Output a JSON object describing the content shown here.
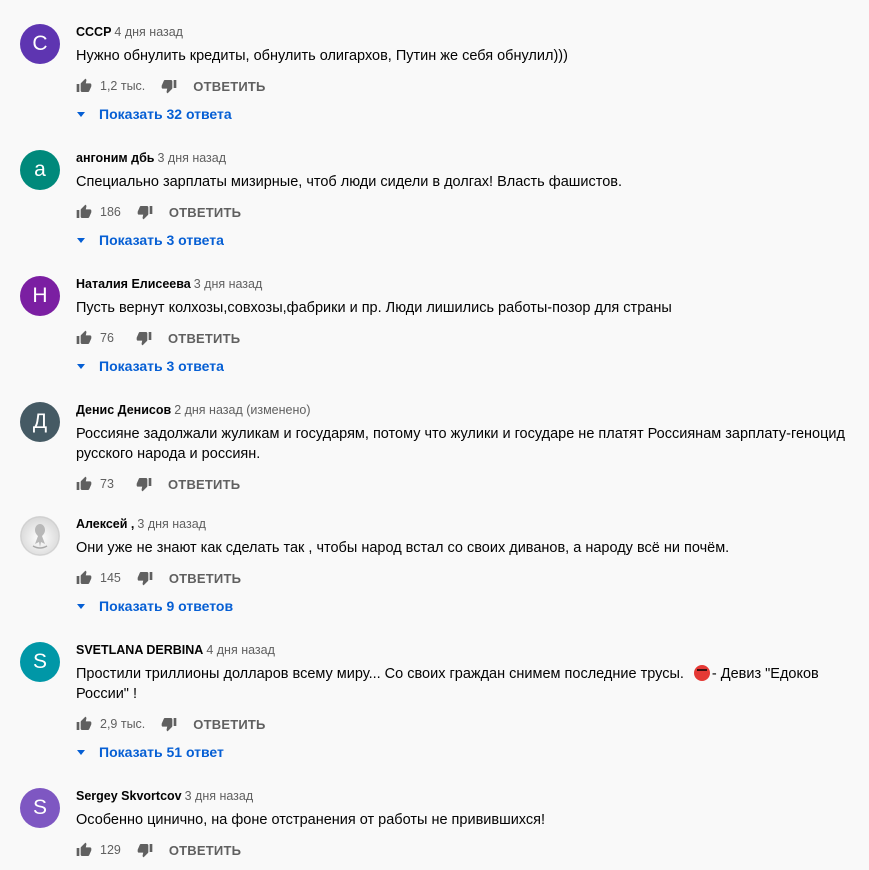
{
  "labels": {
    "reply": "ОТВЕТИТЬ"
  },
  "colors": {
    "link": "#065fd4",
    "muted": "#606060"
  },
  "comments": [
    {
      "avatar_letter": "C",
      "avatar_color": "#5e35b1",
      "author": "СССР",
      "time": "4 дня назад",
      "text": "Нужно обнулить кредиты, обнулить олигархов, Путин же себя обнулил)))",
      "likes": "1,2 тыс.",
      "replies": "Показать 32 ответа"
    },
    {
      "avatar_letter": "а",
      "avatar_color": "#00897b",
      "author": "ангоним дбь",
      "time": "3 дня назад",
      "text": "Специально зарплаты мизирные, чтоб люди сидели в долгах! Власть фашистов.",
      "likes": "186",
      "replies": "Показать 3 ответа"
    },
    {
      "avatar_letter": "Н",
      "avatar_color": "#7b1fa2",
      "author": "Наталия Елисеева",
      "time": "3 дня назад",
      "text": "Пусть вернут колхозы,совхозы,фабрики и пр. Люди лишились работы-позор для страны",
      "likes": "76",
      "replies": "Показать 3 ответа"
    },
    {
      "avatar_letter": "Д",
      "avatar_color": "#455a64",
      "author": "Денис Денисов",
      "time": "2 дня назад (изменено)",
      "text": "Россияне задолжали жуликам и государям, потому что жулики и государе не платят Россиянам зарплату-геноцид русского народа и россиян.",
      "likes": "73",
      "replies": ""
    },
    {
      "avatar_letter": "",
      "avatar_color": "#d8d8d8",
      "author": "Алексей ,",
      "time": "3 дня назад",
      "text": "Они уже не знают как сделать так , чтобы народ встал со своих диванов, а народу всё ни почём.",
      "likes": "145",
      "replies": "Показать 9 ответов"
    },
    {
      "avatar_letter": "S",
      "avatar_color": "#0097a7",
      "author": "SVETLANA DERBINA",
      "time": "4 дня назад",
      "text": "Простили триллионы долларов всему миру... Со своих граждан снимем последние трусы.",
      "text_after": "- Девиз \"Едоков России\" !",
      "likes": "2,9 тыс.",
      "replies": "Показать 51 ответ"
    },
    {
      "avatar_letter": "S",
      "avatar_color": "#7e57c2",
      "author": "Sergey Skvortcov",
      "time": "3 дня назад",
      "text": "Особенно цинично, на фоне отстранения от работы не привившихся!",
      "likes": "129",
      "replies": ""
    }
  ]
}
